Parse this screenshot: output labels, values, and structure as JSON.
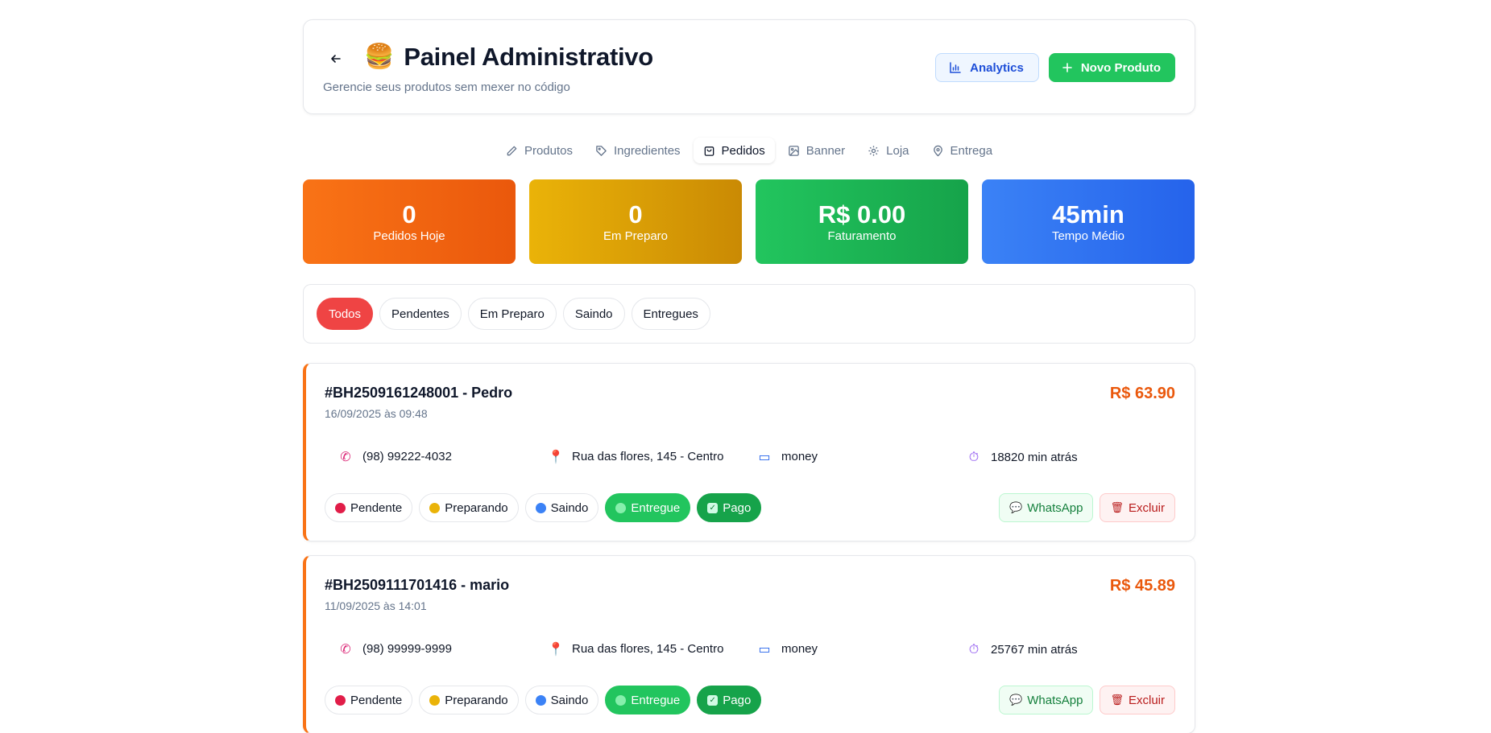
{
  "header": {
    "back_icon": "arrow-left-icon",
    "title_icon": "🍔",
    "title": "Painel Administrativo",
    "subtitle": "Gerencie seus produtos sem mexer no código",
    "analytics_label": "Analytics",
    "new_product_label": "Novo Produto"
  },
  "tabs": [
    {
      "label": "Produtos",
      "icon": "pencil-icon"
    },
    {
      "label": "Ingredientes",
      "icon": "tag-icon"
    },
    {
      "label": "Pedidos",
      "icon": "shopping-bag-icon",
      "active": true
    },
    {
      "label": "Banner",
      "icon": "image-icon"
    },
    {
      "label": "Loja",
      "icon": "gear-icon"
    },
    {
      "label": "Entrega",
      "icon": "map-pin-icon"
    }
  ],
  "stats": [
    {
      "value": "0",
      "label": "Pedidos Hoje"
    },
    {
      "value": "0",
      "label": "Em Preparo"
    },
    {
      "value": "R$ 0.00",
      "label": "Faturamento"
    },
    {
      "value": "45min",
      "label": "Tempo Médio"
    }
  ],
  "filters": [
    "Todos",
    "Pendentes",
    "Em Preparo",
    "Saindo",
    "Entregues"
  ],
  "status_buttons": [
    "Pendente",
    "Preparando",
    "Saindo",
    "Entregue",
    "Pago"
  ],
  "action_labels": {
    "whatsapp": "WhatsApp",
    "delete": "Excluir"
  },
  "colors": {
    "accent_orange": "#ea580c",
    "active_filter": "#ef4444",
    "success": "#22c55e"
  },
  "orders": [
    {
      "id": "#BH2509161248001 - Pedro",
      "date": "16/09/2025 às 09:48",
      "total": "R$ 63.90",
      "phone": "(98) 99222-4032",
      "address": "Rua das flores, 145 - Centro",
      "payment": "money",
      "elapsed": "18820 min atrás"
    },
    {
      "id": "#BH2509111701416 - mario",
      "date": "11/09/2025 às 14:01",
      "total": "R$ 45.89",
      "phone": "(98) 99999-9999",
      "address": "Rua das flores, 145 - Centro",
      "payment": "money",
      "elapsed": "25767 min atrás"
    }
  ]
}
